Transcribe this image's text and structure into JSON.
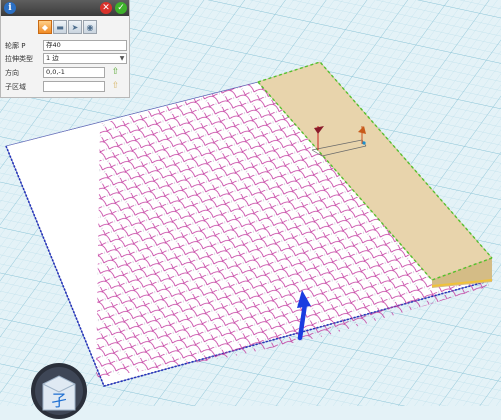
{
  "panel": {
    "info_glyph": "i",
    "close_glyph": "✕",
    "ok_glyph": "✓",
    "modes": [
      {
        "icon": "diamond-icon",
        "active": true
      },
      {
        "icon": "plate-icon",
        "active": false
      },
      {
        "icon": "arrow-plate-icon",
        "active": false
      },
      {
        "icon": "eye-plate-icon",
        "active": false
      }
    ],
    "profile_label": "轮廓 P",
    "profile_value": "存40",
    "extrude_type_label": "拉伸类型",
    "extrude_type_value": "1 边",
    "direction_label": "方向",
    "direction_value": "0,0,-1",
    "subregion_label": "子区域",
    "subregion_value": ""
  },
  "logo": {
    "glyph": "孑"
  },
  "colors": {
    "background": "#e4f2f7",
    "grid_line": "#a8d4e2",
    "plate": "#ffffff",
    "pattern": "#c0309a",
    "strip": "#e8d4ac",
    "strip_edge": "#55c02c",
    "arrow": "#1a3ce0"
  }
}
